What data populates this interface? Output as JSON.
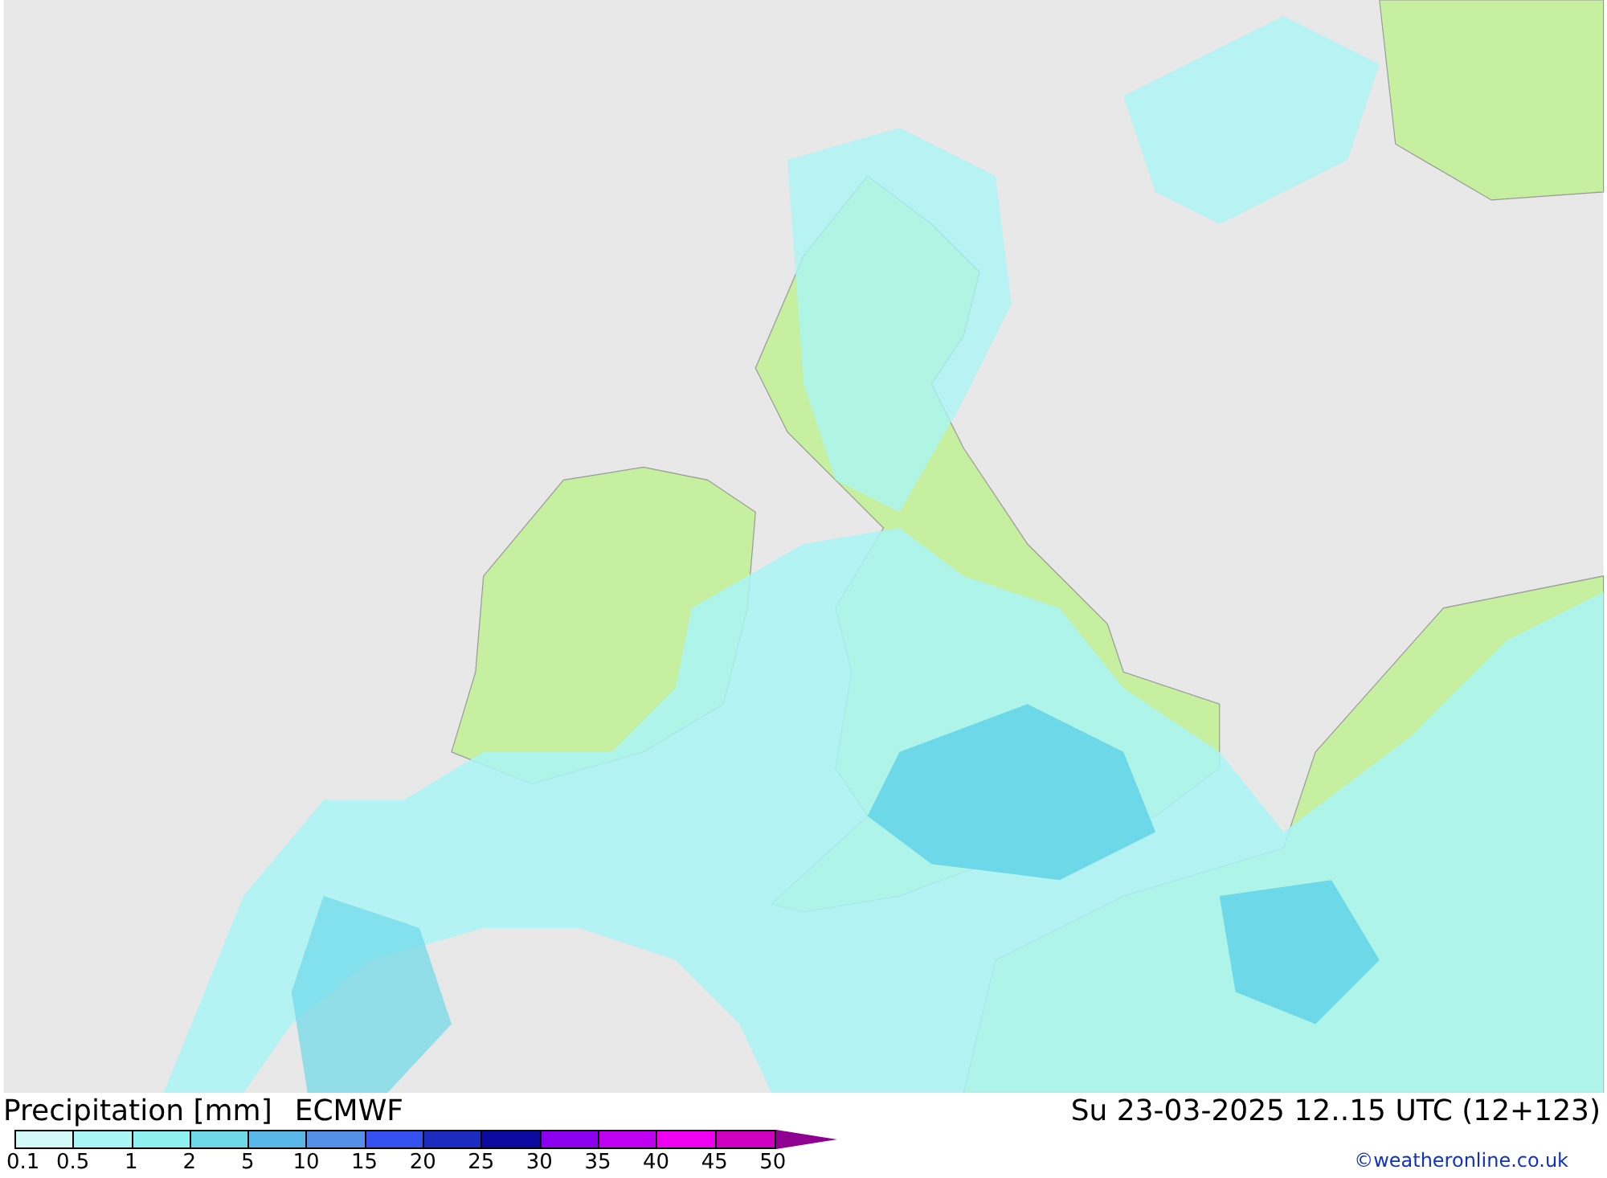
{
  "title": {
    "label": "Precipitation [mm]",
    "model": "ECMWF"
  },
  "valid_time": "Su 23-03-2025 12..15 UTC (12+123)",
  "legend": {
    "swatches": [
      {
        "color": "#d4f8f8"
      },
      {
        "color": "#aaf5f5"
      },
      {
        "color": "#8ef0f0"
      },
      {
        "color": "#6cd8e8"
      },
      {
        "color": "#5ab8e8"
      },
      {
        "color": "#5590e8"
      },
      {
        "color": "#3450f0"
      },
      {
        "color": "#1c2cc0"
      },
      {
        "color": "#0a0aa0"
      },
      {
        "color": "#8c00f0"
      },
      {
        "color": "#c000f0"
      },
      {
        "color": "#f000f0"
      },
      {
        "color": "#d000c0"
      },
      {
        "kind": "arrow",
        "color": "#900090"
      }
    ],
    "labels": [
      "0.1",
      "0.5",
      "1",
      "2",
      "5",
      "10",
      "15",
      "20",
      "25",
      "30",
      "35",
      "40",
      "45",
      "50"
    ]
  },
  "credit": "©weatheronline.co.uk"
}
